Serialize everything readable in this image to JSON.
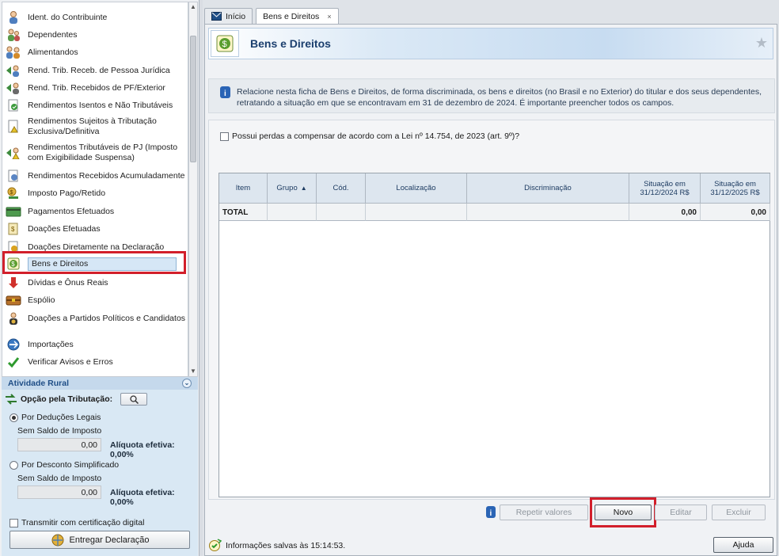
{
  "sidebar": {
    "items": [
      {
        "label": "Ident. do Contribuinte",
        "icon": "person-icon"
      },
      {
        "label": "Dependentes",
        "icon": "people-icon"
      },
      {
        "label": "Alimentandos",
        "icon": "family-icon"
      },
      {
        "label": "Rend. Trib. Receb. de Pessoa Jurídica",
        "icon": "income-company-icon"
      },
      {
        "label": "Rend. Trib. Recebidos de PF/Exterior",
        "icon": "income-person-icon"
      },
      {
        "label": "Rendimentos Isentos e Não Tributáveis",
        "icon": "exempt-income-icon"
      },
      {
        "label": "Rendimentos Sujeitos à Tributação Exclusiva/Definitiva",
        "icon": "exclusive-income-icon"
      },
      {
        "label": "Rendimentos Tributáveis de PJ (Imposto com Exigibilidade Suspensa)",
        "icon": "suspended-income-icon"
      },
      {
        "label": "Rendimentos Recebidos Acumuladamente",
        "icon": "accumulated-income-icon"
      },
      {
        "label": "Imposto Pago/Retido",
        "icon": "tax-paid-icon"
      },
      {
        "label": "Pagamentos Efetuados",
        "icon": "payment-card-icon"
      },
      {
        "label": "Doações Efetuadas",
        "icon": "donation-icon"
      },
      {
        "label": "Doações Diretamente na Declaração",
        "icon": "direct-donation-icon"
      },
      {
        "label": "Bens e Direitos",
        "icon": "assets-icon"
      },
      {
        "label": "Dívidas e Ônus Reais",
        "icon": "debt-arrow-icon"
      },
      {
        "label": "Espólio",
        "icon": "chest-icon"
      },
      {
        "label": "Doações a Partidos Políticos e Candidatos",
        "icon": "political-donation-icon"
      },
      {
        "label": "Importações",
        "icon": "import-icon"
      },
      {
        "label": "Verificar Avisos e Erros",
        "icon": "checkmark-icon"
      }
    ],
    "selected_index": 13,
    "rural": {
      "header": "Atividade Rural",
      "opcao_label": "Opção pela Tributação:",
      "deducoes_label": "Por Deduções Legais",
      "sem_saldo_1": "Sem Saldo de Imposto",
      "valor_1": "0,00",
      "aliquota_1": "Alíquota efetiva: 0,00%",
      "simplificado_label": "Por Desconto Simplificado",
      "sem_saldo_2": "Sem Saldo de Imposto",
      "valor_2": "0,00",
      "aliquota_2": "Alíquota efetiva: 0,00%",
      "certificacao_label": "Transmitir com certificação digital",
      "entregar_label": "Entregar Declaração"
    }
  },
  "tabs": [
    {
      "label": "Início",
      "active": false
    },
    {
      "label": "Bens e Direitos",
      "active": true,
      "close": "×"
    }
  ],
  "page": {
    "title": "Bens e Direitos",
    "info_text": "Relacione nesta ficha de Bens e Direitos, de forma discriminada, os bens e direitos (no Brasil e no Exterior) do titular e dos seus dependentes, retratando a situação em que se encontravam em 31 de dezembro de 2024. É importante preencher todos os campos.",
    "perdas_label": "Possui perdas a compensar de acordo com a Lei nº 14.754, de 2023 (art. 9º)?",
    "table": {
      "headers": [
        "Item",
        "Grupo",
        "Cód.",
        "Localização",
        "Discriminação",
        "Situação em 31/12/2024 R$",
        "Situação em 31/12/2025 R$"
      ],
      "total_label": "TOTAL",
      "total_2024": "0,00",
      "total_2025": "0,00",
      "sort_column": "Grupo",
      "sort_arrow": "▲"
    },
    "buttons": {
      "repetir": "Repetir valores",
      "novo": "Novo",
      "editar": "Editar",
      "excluir": "Excluir",
      "ajuda": "Ajuda"
    },
    "status": "Informações salvas às 15:14:53."
  },
  "colors": {
    "highlight": "#d21f2b",
    "accent": "#1b3f6e"
  }
}
